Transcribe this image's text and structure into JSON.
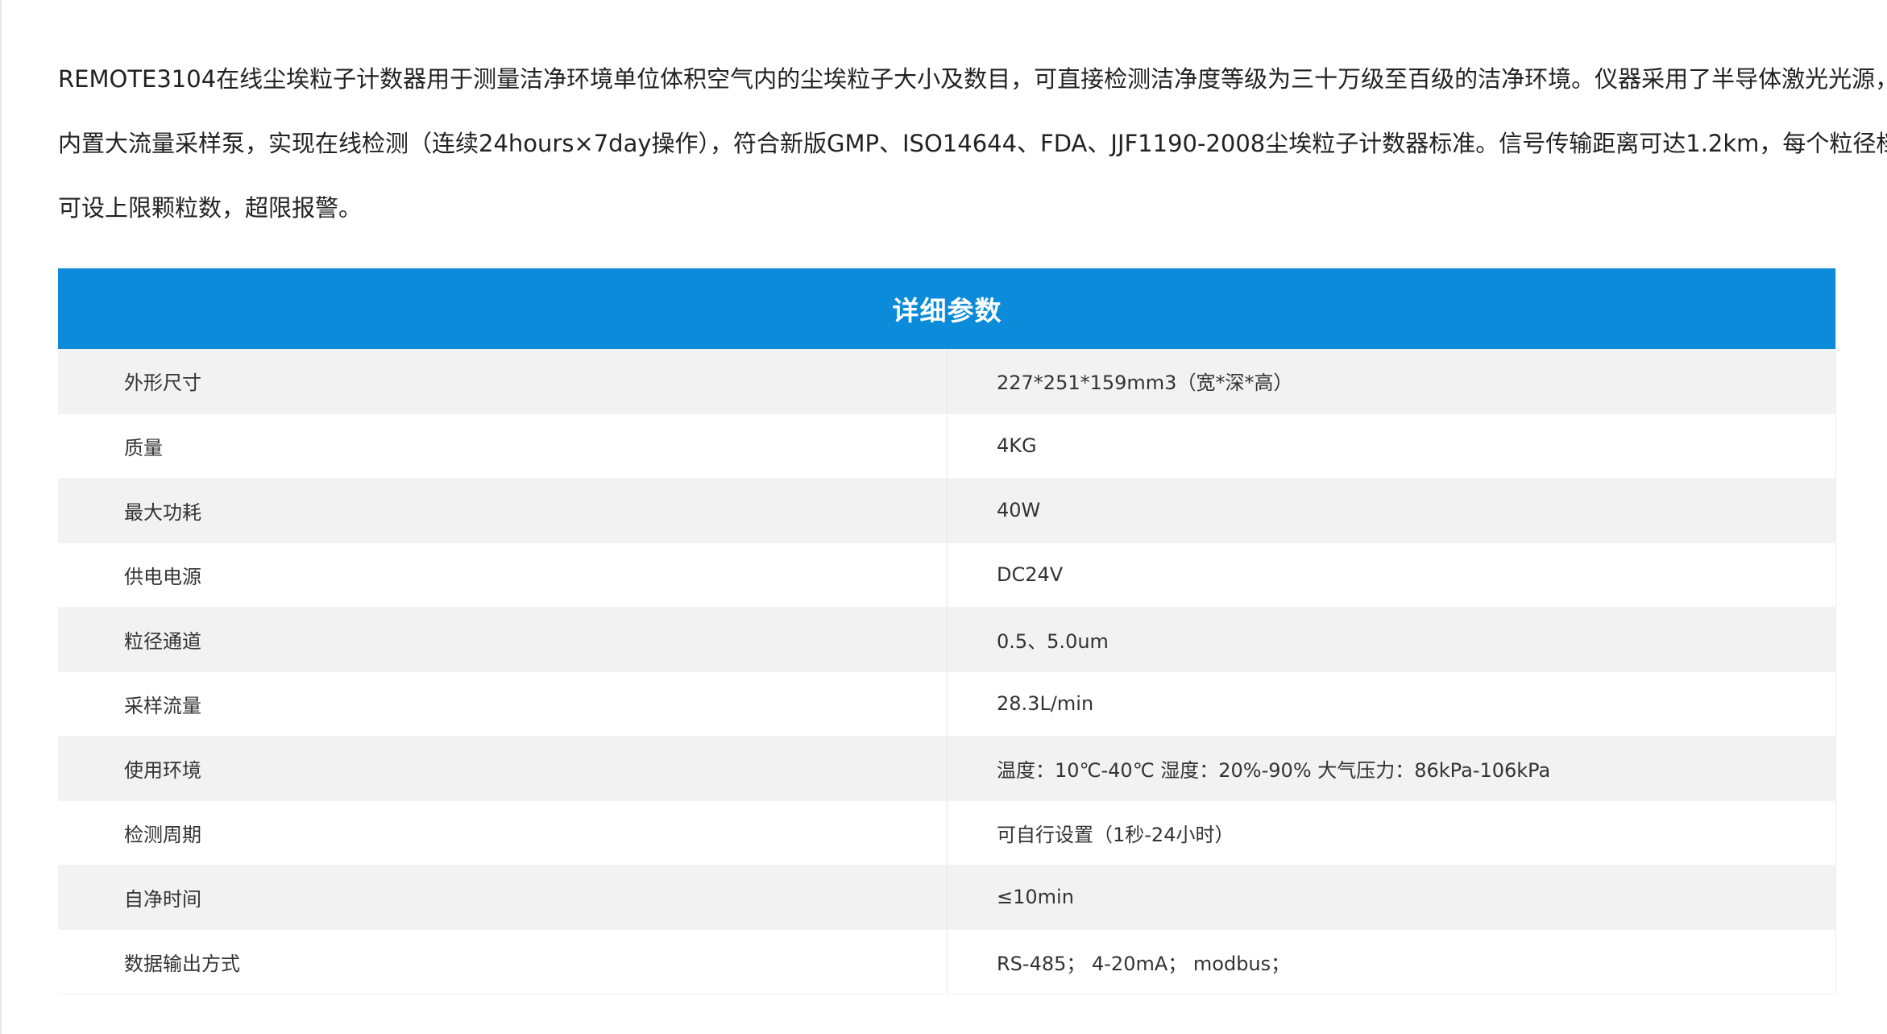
{
  "intro": {
    "lines": [
      "REMOTE3104在线尘埃粒子计数器用于测量洁净环境单位体积空气内的尘埃粒子大小及数目，可直接检测洁净度等级为三十万级至百级的洁净环境。仪器采用了半导体激光光源，",
      "内置大流量采样泵，实现在线检测（连续24hours×7day操作），符合新版GMP、ISO14644、FDA、JJF1190-2008尘埃粒子计数器标准。信号传输距离可达1.2km，每个粒径档",
      "可设上限颗粒数，超限报警。"
    ]
  },
  "spec_table": {
    "heading": "详细参数",
    "header_color": "#0b8bd9",
    "rows": [
      {
        "label": "外形尺寸",
        "value": "227*251*159mm3（宽*深*高）"
      },
      {
        "label": "质量",
        "value": "4KG"
      },
      {
        "label": "最大功耗",
        "value": "40W"
      },
      {
        "label": "供电电源",
        "value": "DC24V"
      },
      {
        "label": "粒径通道",
        "value": "0.5、5.0um"
      },
      {
        "label": "采样流量",
        "value": "28.3L/min"
      },
      {
        "label": "使用环境",
        "value": "温度：10℃-40℃ 湿度：20%-90% 大气压力：86kPa-106kPa"
      },
      {
        "label": "检测周期",
        "value": "可自行设置（1秒-24小时）"
      },
      {
        "label": "自净时间",
        "value": "≤10min"
      },
      {
        "label": "数据输出方式",
        "value": "RS-485； 4-20mA； modbus；"
      }
    ]
  }
}
